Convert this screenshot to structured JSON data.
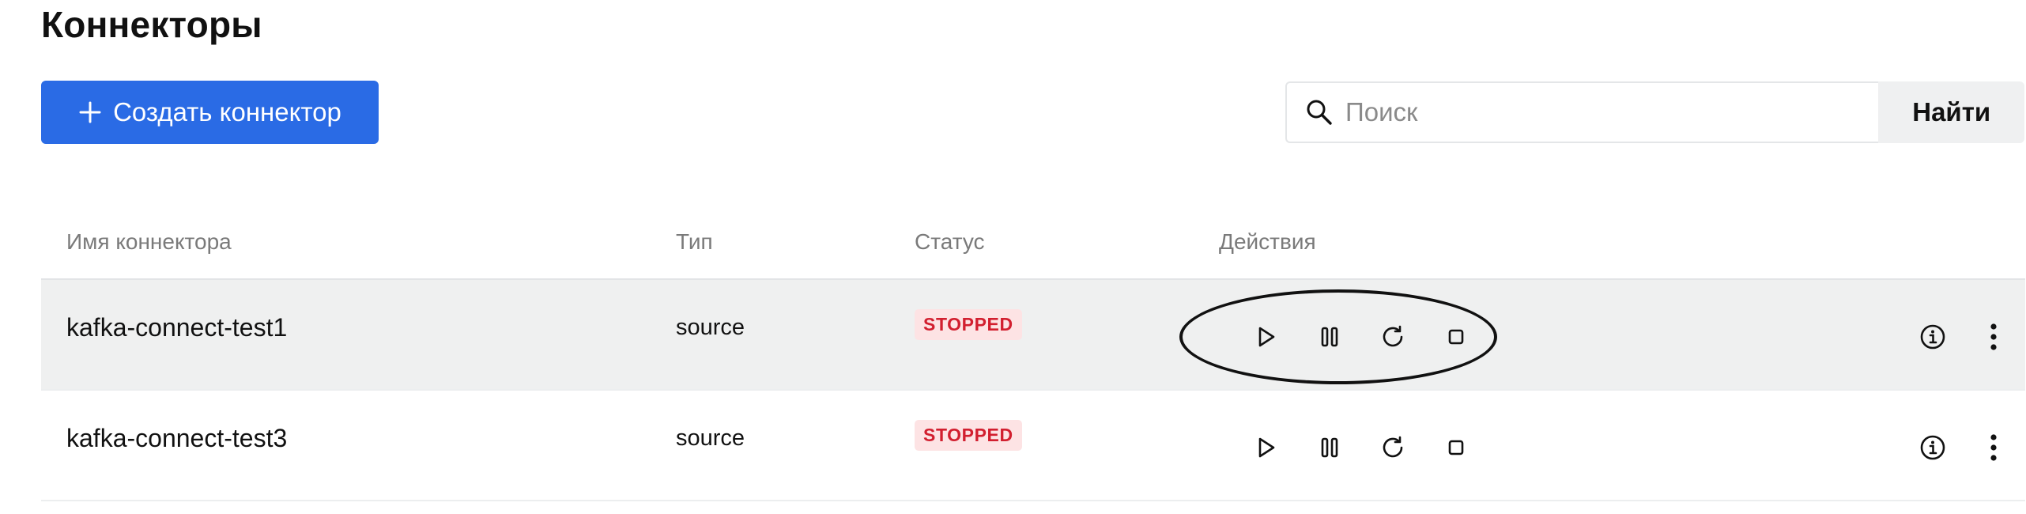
{
  "page": {
    "title": "Коннекторы"
  },
  "toolbar": {
    "create_label": "Создать коннектор",
    "search_placeholder": "Поиск",
    "search_value": "",
    "find_label": "Найти"
  },
  "table": {
    "headers": {
      "name": "Имя коннектора",
      "type": "Тип",
      "status": "Статус",
      "actions": "Действия"
    },
    "rows": [
      {
        "name": "kafka-connect-test1",
        "type": "source",
        "status": "STOPPED",
        "highlighted": true
      },
      {
        "name": "kafka-connect-test3",
        "type": "source",
        "status": "STOPPED",
        "highlighted": false
      }
    ],
    "row_actions": [
      "play-icon",
      "pause-icon",
      "restart-icon",
      "stop-icon"
    ],
    "row_extras": [
      "info-icon",
      "more-vertical-icon"
    ]
  },
  "colors": {
    "accent": "#2a6be5",
    "status_stopped_text": "#d21f2f",
    "status_stopped_bg": "#fde3e4",
    "row_highlight_bg": "#eff0f0"
  },
  "annotation": {
    "ellipse_around": "row-actions-1"
  }
}
